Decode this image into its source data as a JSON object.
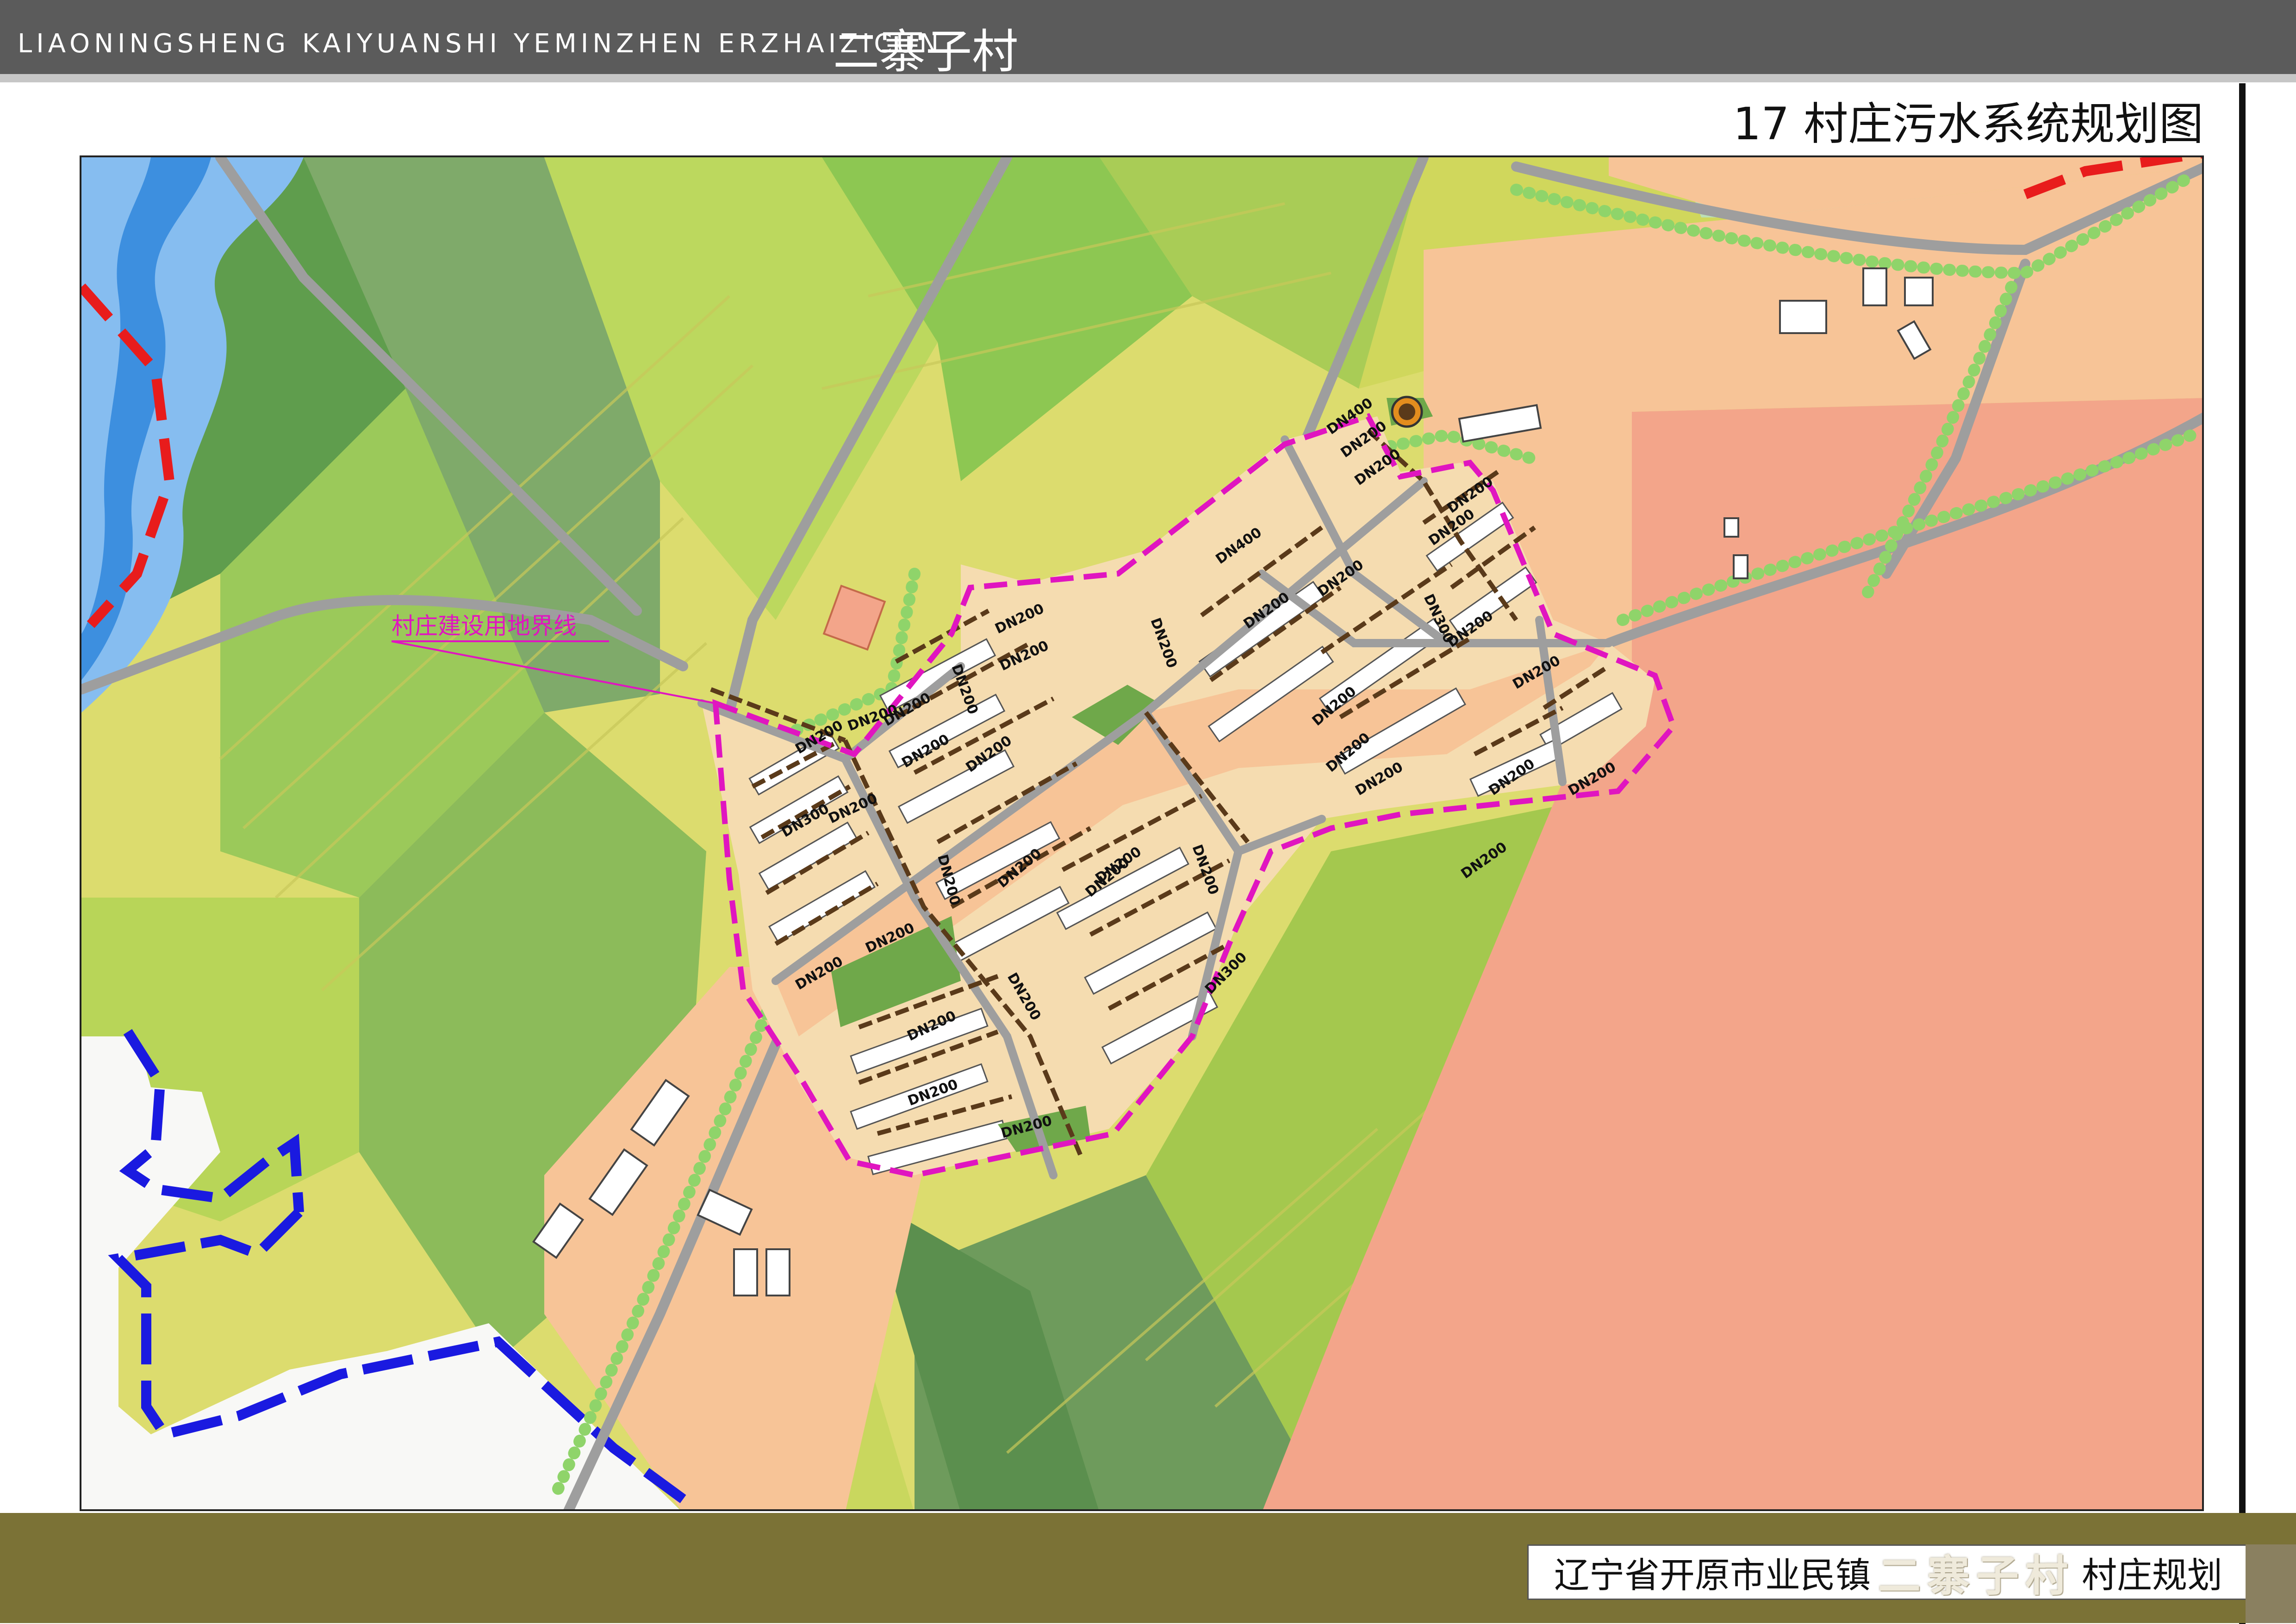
{
  "header": {
    "project_latin": "LIAONINGSHENG KAIYUANSHI YEMINZHEN ERZHAIZICUN",
    "project_cn": "二寨子村"
  },
  "sheet": {
    "title": "17 村庄污水系统规划图"
  },
  "map": {
    "annotation": "村庄建设用地界线",
    "facility_icon": "sewage-treatment-station-icon",
    "pipe_labels": [
      "DN400",
      "DN200",
      "DN200",
      "DN200",
      "DN400",
      "DN300",
      "DN200",
      "DN200",
      "DN200",
      "DN200",
      "DN200",
      "DN200",
      "DN200",
      "DN200",
      "DN200",
      "DN200",
      "DN200",
      "DN300",
      "DN200",
      "DN200",
      "DN200",
      "DN200",
      "DN200",
      "DN200",
      "DN200",
      "DN200",
      "DN200",
      "DN300",
      "DN200",
      "DN200",
      "DN200",
      "DN200",
      "DN200",
      "DN200",
      "DN200",
      "DN200",
      "DN200",
      "DN200",
      "DN200",
      "DN200"
    ],
    "colors": {
      "boundary": "#e015c0",
      "sewer_pipe": "#5a3a1a",
      "road": "#9e9e9e",
      "residential": "#f5dcb0",
      "orange_zone": "#f7c497",
      "salmon_zone": "#f3a58a",
      "river": "#3d8fdf",
      "river_bank": "#86bdf0",
      "boundary_blue": "#1a1ae0",
      "boundary_red": "#e81c1c"
    }
  },
  "footer": {
    "prefix": "辽宁省开原市业民镇",
    "village": "二寨子村",
    "suffix": "村庄规划"
  }
}
